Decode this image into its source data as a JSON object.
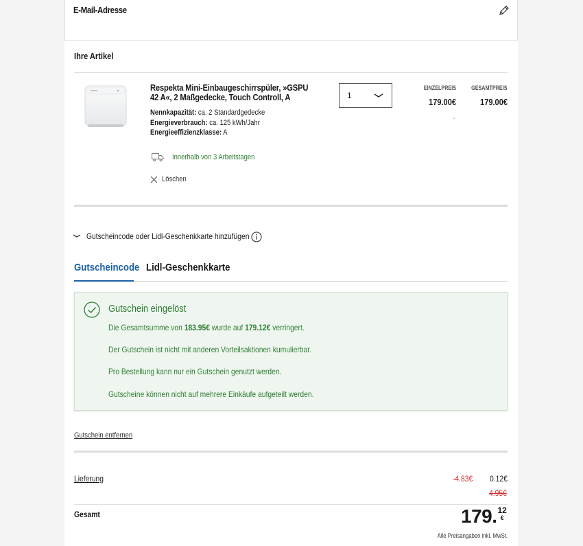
{
  "email": {
    "title": "E-Mail-Adresse",
    "edit_icon": "pencil-icon"
  },
  "cart": {
    "title": "Ihre Artikel",
    "item": {
      "name": "Respekta Mini-Einbaugeschirrspüler, »GSPU 42 A«, 2 Maßgedecke, Touch Controll, A",
      "specs": [
        {
          "label": "Nennkapazität:",
          "value": "ca. 2 Standardgedecke"
        },
        {
          "label": "Energieverbrauch:",
          "value": "ca. 125 kWh/Jahr"
        },
        {
          "label": "Energieeffizienzklasse:",
          "value": "A"
        }
      ],
      "quantity": "1",
      "unit_price_label": "EINZELPREIS",
      "unit_price": "179.00€",
      "total_price_label": "GESAMTPREIS",
      "total_price": "179.00€",
      "unit_price_sub": "-",
      "delivery": "Innerhalb von 3 Arbeitstagen",
      "delete_label": "Löschen"
    }
  },
  "coupon": {
    "toggle_label": "Gutscheincode oder Lidl-Geschenkkarte hinzufügen",
    "tabs": [
      {
        "label": "Gutscheincode",
        "active": true
      },
      {
        "label": "Lidl-Geschenkkarte",
        "active": false
      }
    ],
    "success": {
      "title": "Gutschein eingelöst",
      "line1_prefix": "Die Gesamtsumme von ",
      "old_total": "183.95€",
      "line1_mid": " wurde auf ",
      "new_total": "179.12€",
      "line1_suffix": " verringert.",
      "line2": "Der Gutschein ist nicht mit anderen Vorteilsaktionen kumulierbar.",
      "line3": "Pro Bestellung kann nur ein Gutschein genutzt werden.",
      "line4": "Gutscheine können nicht auf mehrere Einkäufe aufgeteilt werden."
    },
    "remove_label": "Gutschein entfernen"
  },
  "summary": {
    "delivery_label": "Lieferung",
    "delivery_discount": "-4.83€",
    "delivery_price": "0.12€",
    "delivery_original": "4.95€",
    "total_label": "Gesamt",
    "total_main": "179.",
    "total_cents": "12",
    "total_currency": "€",
    "vat_note": "Alle Preisangaben inkl. MwSt."
  },
  "colors": {
    "accent": "#1a5fa3",
    "success": "#2e7d32",
    "discount": "#d32f2f"
  }
}
